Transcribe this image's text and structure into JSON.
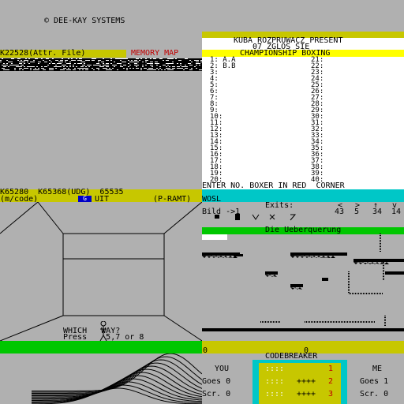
{
  "copyright": "© DEE-KAY SYSTEMS",
  "memory_map": {
    "attr_label": "K22528(Attr. File)",
    "title": "MEMORY MAP",
    "mcode_line1": "K65280  K65368(UDG)  65535",
    "mcode_left": "(m/code)",
    "uit": "UIT",
    "uit_marker": "G",
    "pramt": "(P-RAMT)"
  },
  "boxing": {
    "title1": "KUBA ROZPRUWACZ PRESENT",
    "title2": "07 ZGLOS SIE",
    "banner": "CHAMPIONSHIP BOXING",
    "left_entries": [
      "1: A.A",
      "2: B.B",
      "3:",
      "4:",
      "5:",
      "6:",
      "7:",
      "8:",
      "9:",
      "10:",
      "11:",
      "12:",
      "13:",
      "14:",
      "15:",
      "16:",
      "17:",
      "18:",
      "19:",
      "20:"
    ],
    "right_entries": [
      "21:",
      "22:",
      "23:",
      "24:",
      "25:",
      "26:",
      "27:",
      "28:",
      "29:",
      "30:",
      "31:",
      "32:",
      "33:",
      "34:",
      "35:",
      "36:",
      "37:",
      "38:",
      "39:",
      "40:"
    ],
    "prompt": "ENTER NO. BOXER IN RED  CORNER"
  },
  "adventure": {
    "wosl": "WOSL",
    "exits_label": "Exits:",
    "bild_label": "Bild ->1",
    "exit_dirs": [
      "<",
      ">",
      "↑",
      "v"
    ],
    "exit_nums": [
      "43",
      "5",
      "34",
      "14"
    ]
  },
  "platform": {
    "title": "Die Ueberquerung",
    "score_left": "0",
    "score_right": "0"
  },
  "maze": {
    "which_way": "WHICH   WAY?",
    "press": "Press    5,7 or 8"
  },
  "codebreaker": {
    "title": "CODEBREAKER",
    "you_label": "YOU",
    "me_label": "ME",
    "you_goes": "Goes 0",
    "you_scr": "Scr. 0",
    "me_goes": "Goes 1",
    "me_scr": "Scr. 0",
    "rows": [
      {
        "pegs": "::::",
        "marks": "",
        "num": "1"
      },
      {
        "pegs": "::::",
        "marks": "++++",
        "num": "2"
      },
      {
        "pegs": "::::",
        "marks": "++++",
        "num": "3"
      }
    ]
  },
  "colors": {
    "gray": "#b0b0b0",
    "yellow": "#c7c700",
    "cyan": "#00c7c7",
    "green": "#00c700",
    "red": "#c00000",
    "blue": "#0000c7"
  }
}
